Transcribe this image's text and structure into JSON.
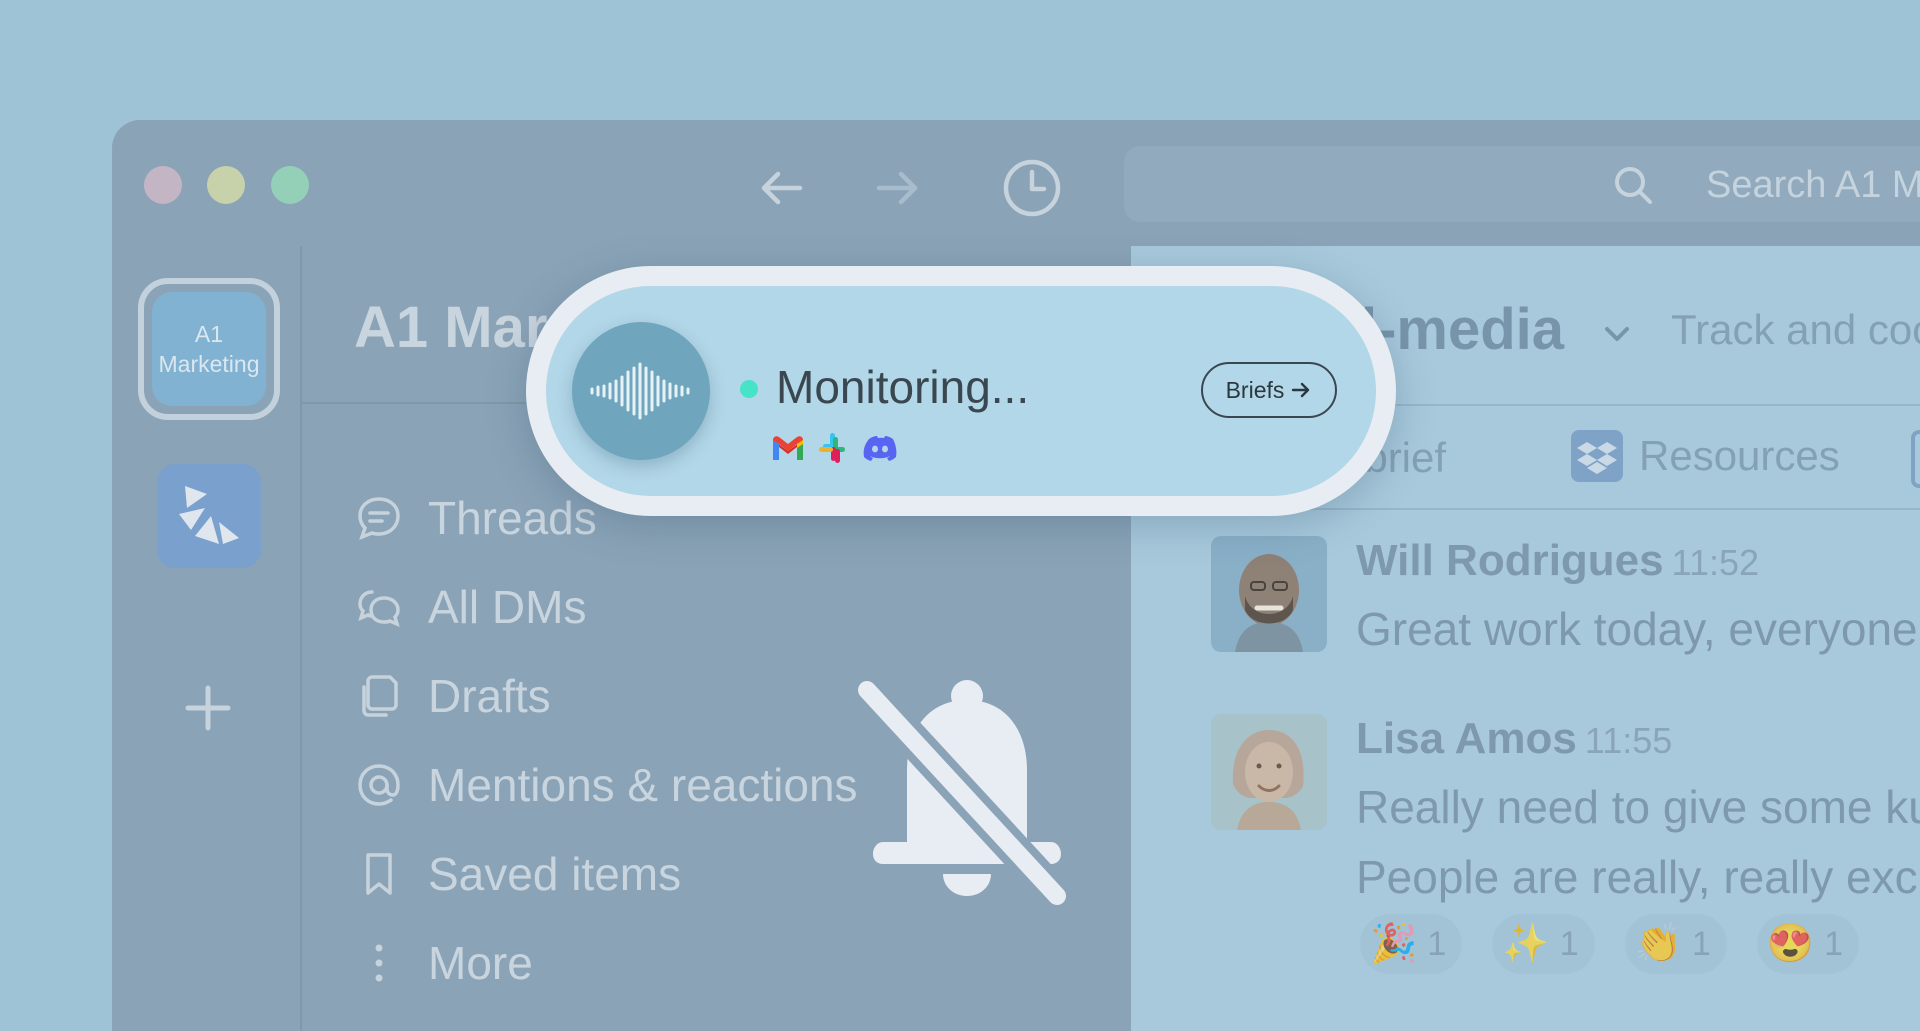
{
  "window": {
    "search_placeholder": "Search A1 M",
    "traffic_lights": [
      "#c4b5c4",
      "#c7d1aa",
      "#94d0b8"
    ]
  },
  "rail": {
    "workspace_label_line1": "A1",
    "workspace_label_line2": "Marketing"
  },
  "sidebar": {
    "workspace_title": "A1 Mar",
    "items": [
      {
        "label": "Threads",
        "icon": "threads-icon"
      },
      {
        "label": "All DMs",
        "icon": "dms-icon"
      },
      {
        "label": "Drafts",
        "icon": "drafts-icon"
      },
      {
        "label": "Mentions & reactions",
        "icon": "mention-icon"
      },
      {
        "label": "Saved items",
        "icon": "bookmark-icon"
      },
      {
        "label": "More",
        "icon": "more-icon"
      }
    ]
  },
  "channel": {
    "name": "l-media",
    "description": "Track and coor",
    "tabs": [
      "t brief",
      "Resources"
    ]
  },
  "messages": [
    {
      "author": "Will Rodrigues",
      "time": "11:52",
      "lines": [
        "Great work today, everyone"
      ]
    },
    {
      "author": "Lisa Amos",
      "time": "11:55",
      "lines": [
        "Really need to give some ku",
        "People are really, really exci"
      ]
    }
  ],
  "reactions": [
    {
      "emoji": "🎉",
      "count": "1"
    },
    {
      "emoji": "✨",
      "count": "1"
    },
    {
      "emoji": "👏",
      "count": "1"
    },
    {
      "emoji": "😍",
      "count": "1"
    }
  ],
  "overlay": {
    "status_text": "Monitoring...",
    "briefs_label": "Briefs",
    "sources": [
      "gmail-icon",
      "slack-icon",
      "discord-icon"
    ],
    "status_color": "#47e3c7"
  }
}
